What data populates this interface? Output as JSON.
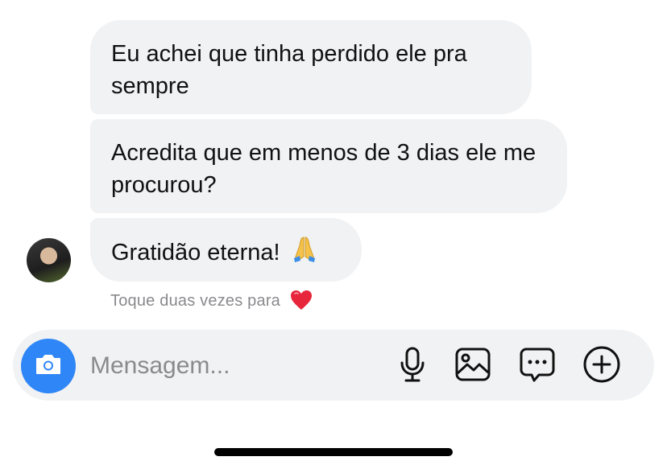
{
  "messages": [
    {
      "text": "Eu achei que tinha perdido ele pra sempre"
    },
    {
      "text": "Acredita que em menos de 3 dias ele me procurou?"
    },
    {
      "text": "Gratidão eterna!",
      "emoji": "🙏"
    }
  ],
  "hint": {
    "text": "Toque duas vezes para",
    "emoji": "❤️"
  },
  "composer": {
    "placeholder": "Mensagem...",
    "value": "",
    "icons": [
      "camera-icon",
      "microphone-icon",
      "image-icon",
      "sticker-icon",
      "plus-icon"
    ]
  },
  "colors": {
    "bubble_bg": "#f1f2f4",
    "camera_button": "#2f86f6",
    "hint_text": "#8a8a8e"
  }
}
